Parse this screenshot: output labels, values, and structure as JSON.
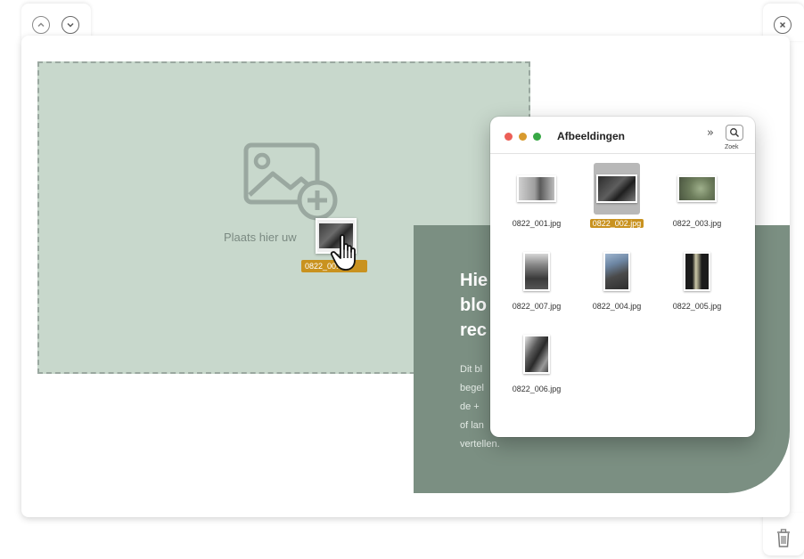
{
  "editor": {
    "dropzone_label": "Plaats hier uw",
    "block_heading_lines": [
      "Hie",
      "blo",
      "rec"
    ],
    "block_body_lines": [
      "Dit bl",
      "begel",
      "de + ",
      "of lan",
      "vertellen."
    ]
  },
  "drag": {
    "filename_label": "0822_00..."
  },
  "finder": {
    "title": "Afbeeldingen",
    "more_glyph": "»",
    "search_label": "Zoek",
    "traffic_lights": {
      "close": "#ec5f57",
      "minimize": "#d89a2e",
      "zoom": "#38a845"
    },
    "files": [
      {
        "name": "0822_001.jpg",
        "selected": false
      },
      {
        "name": "0822_002.jpg",
        "selected": true
      },
      {
        "name": "0822_003.jpg",
        "selected": false
      },
      {
        "name": "0822_007.jpg",
        "selected": false
      },
      {
        "name": "0822_004.jpg",
        "selected": false
      },
      {
        "name": "0822_005.jpg",
        "selected": false
      },
      {
        "name": "0822_006.jpg",
        "selected": false
      }
    ]
  },
  "colors": {
    "dropzone_bg": "#c8d8cc",
    "block_bg": "#7b8f82",
    "selection": "#c9921f"
  },
  "icons": {
    "up": "chevron-up-icon",
    "down": "chevron-down-icon",
    "close": "close-icon",
    "trash": "trash-icon",
    "search": "search-icon",
    "image_add": "image-add-icon",
    "cursor": "hand-cursor-icon"
  }
}
